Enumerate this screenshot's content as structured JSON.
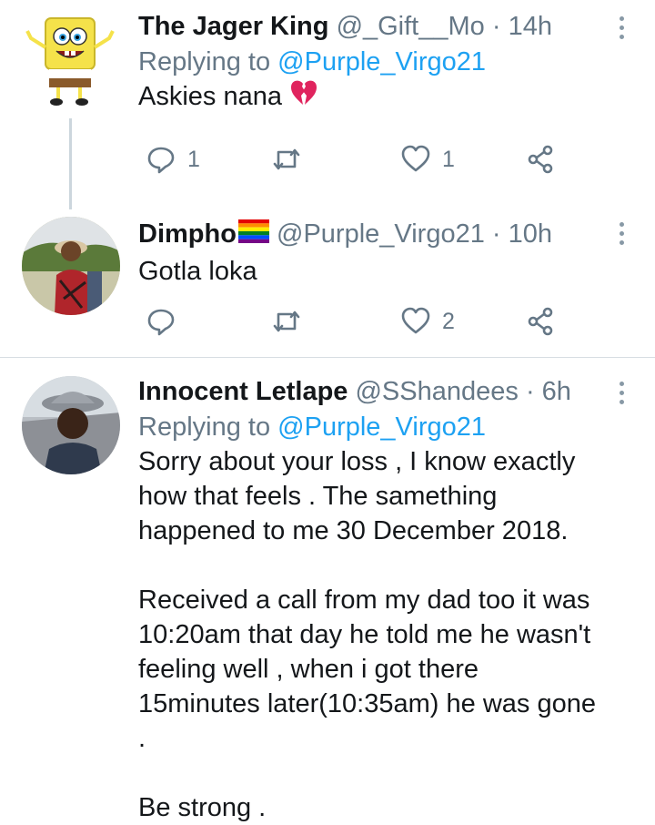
{
  "tweets": [
    {
      "name": "The Jager King",
      "handle": "@_Gift__Mo",
      "time": "· 14h",
      "replying_prefix": "Replying to ",
      "replying_to": "@Purple_Virgo21",
      "text": "Askies nana",
      "text_emoji": "broken-heart-icon",
      "replies": "1",
      "retweets": "",
      "likes": "1"
    },
    {
      "name": "Dimpho",
      "name_emoji": "rainbow-flag-icon",
      "handle": "@Purple_Virgo21",
      "time": "· 10h",
      "text": "Gotla loka",
      "replies": "",
      "retweets": "",
      "likes": "2"
    },
    {
      "name": "Innocent Letlape",
      "handle": "@SShandees",
      "time": "· 6h",
      "replying_prefix": "Replying to ",
      "replying_to": "@Purple_Virgo21",
      "paragraphs": [
        "Sorry about your loss , I know exactly how that feels . The samething happened to me 30 December 2018.",
        "Received a call from my dad too it was 10:20am that day he told me he wasn't feeling well , when i got there 15minutes later(10:35am) he was gone .",
        "Be strong ."
      ]
    }
  ],
  "colors": {
    "link": "#1da1f2",
    "meta": "#657786",
    "text": "#14171a",
    "divider": "#d7dde2",
    "broken_heart": "#e0245e"
  }
}
